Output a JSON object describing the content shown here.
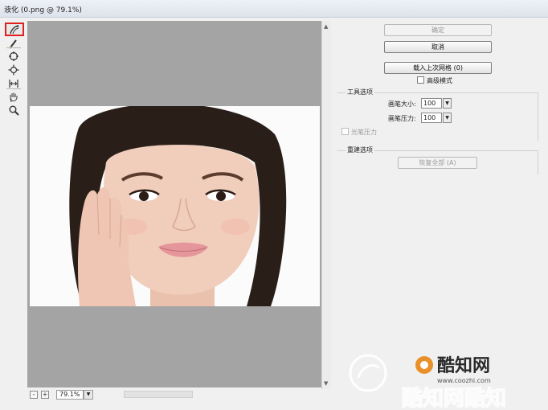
{
  "window": {
    "title": "液化 (0.png @ 79.1%)"
  },
  "tools": [
    {
      "icon": "forward-warp-icon"
    },
    {
      "icon": "reconstruct-brush-icon"
    },
    {
      "icon": "pucker-icon"
    },
    {
      "icon": "bloat-icon"
    },
    {
      "icon": "push-left-icon"
    },
    {
      "icon": "hand-icon"
    },
    {
      "icon": "zoom-icon"
    }
  ],
  "zoom": {
    "value": "79.1%",
    "minus": "-",
    "plus": "+"
  },
  "buttons": {
    "ok": "确定",
    "cancel": "取消",
    "load_mesh": "载入上次网格 (0)"
  },
  "advanced_mode": {
    "label": "高级模式",
    "checked": false
  },
  "tool_options": {
    "title": "工具选项",
    "brush_size_label": "画笔大小:",
    "brush_size_value": "100",
    "brush_pressure_label": "画笔压力:",
    "brush_pressure_value": "100",
    "stylus_pressure_label": "光笔压力"
  },
  "reconstruct_options": {
    "title": "重建选项",
    "restore_all": "恢复全部 (A)"
  },
  "watermark": {
    "text": "酷知网",
    "url": "www.coozhi.com"
  },
  "colors": {
    "annotation": "#e02020",
    "canvas_bg": "#a4a4a4",
    "watermark": "#e8902a"
  }
}
